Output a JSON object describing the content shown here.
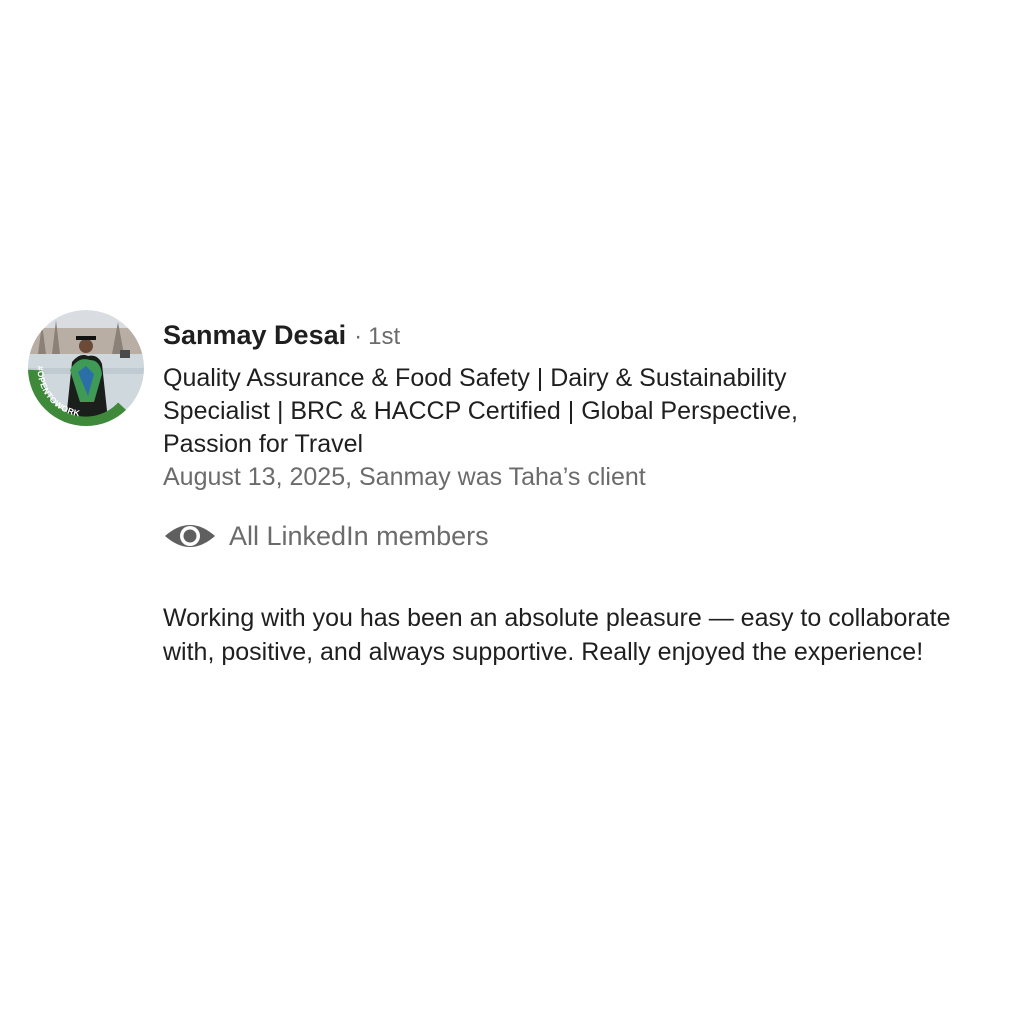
{
  "recommendation": {
    "author": {
      "name": "Sanmay Desai",
      "separator": "·",
      "connection_degree": "1st",
      "avatar_badge": "#OPENTOWORK",
      "headline": "Quality Assurance & Food Safety | Dairy & Sustainability Specialist | BRC & HACCP Certified | Global Perspective, Passion for Travel"
    },
    "meta": "August 13, 2025, Sanmay was Taha’s client",
    "visibility": {
      "icon": "eye-icon",
      "label": "All LinkedIn members"
    },
    "text": "Working with you has been an absolute pleasure — easy to collaborate with, positive, and always supportive. Really enjoyed the experience!"
  },
  "colors": {
    "badge_green": "#3f8a3a",
    "secondary_text": "#6b6b6b",
    "primary_text": "#1f1f1f"
  }
}
